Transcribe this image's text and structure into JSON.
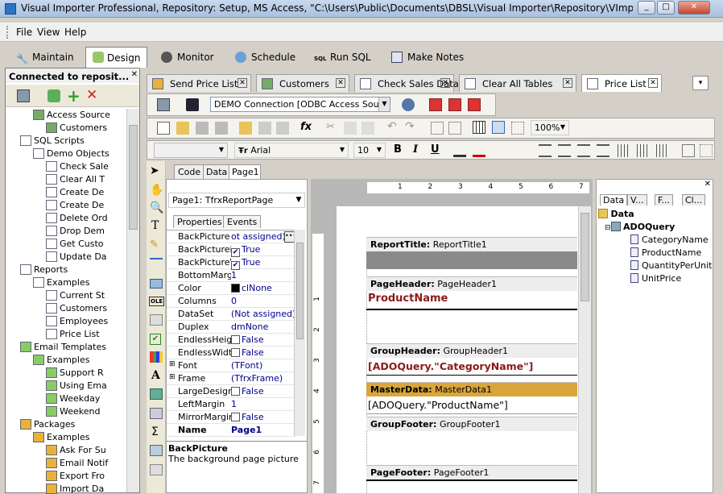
{
  "window": {
    "title": "Visual Importer Professional, Repository: Setup, MS Access, \"C:\\Users\\Public\\Documents\\DBSL\\Visual Importer\\Repository\\VImpRepository.m..."
  },
  "menu": [
    "File",
    "View",
    "Help"
  ],
  "main_tabs": [
    {
      "label": "Maintain",
      "icon": "wrench-icon"
    },
    {
      "label": "Design",
      "icon": "design-icon"
    },
    {
      "label": "Monitor",
      "icon": "binoculars-icon"
    },
    {
      "label": "Schedule",
      "icon": "clock-icon"
    },
    {
      "label": "Run SQL",
      "icon": "sql-icon"
    },
    {
      "label": "Make Notes",
      "icon": "notes-icon"
    }
  ],
  "left_panel": {
    "title": "Connected to reposit...",
    "tree": [
      {
        "label": "Access Source",
        "level": 3,
        "icon": "batch-icon"
      },
      {
        "label": "Customers",
        "level": 4,
        "icon": "batch-icon"
      },
      {
        "label": "SQL Scripts",
        "level": 2,
        "icon": "sql-icon"
      },
      {
        "label": "Demo Objects",
        "level": 3,
        "icon": "sql-icon"
      },
      {
        "label": "Check Sale",
        "level": 4,
        "icon": "sql-icon"
      },
      {
        "label": "Clear All T",
        "level": 4,
        "icon": "sql-icon"
      },
      {
        "label": "Create De",
        "level": 4,
        "icon": "sql-icon"
      },
      {
        "label": "Create De",
        "level": 4,
        "icon": "sql-icon"
      },
      {
        "label": "Delete Ord",
        "level": 4,
        "icon": "sql-icon"
      },
      {
        "label": "Drop Dem",
        "level": 4,
        "icon": "sql-icon"
      },
      {
        "label": "Get Custo",
        "level": 4,
        "icon": "sql-icon"
      },
      {
        "label": "Update Da",
        "level": 4,
        "icon": "sql-icon"
      },
      {
        "label": "Reports",
        "level": 2,
        "icon": "report-icon"
      },
      {
        "label": "Examples",
        "level": 3,
        "icon": "report-icon"
      },
      {
        "label": "Current St",
        "level": 4,
        "icon": "report-icon"
      },
      {
        "label": "Customers",
        "level": 4,
        "icon": "report-icon"
      },
      {
        "label": "Employees",
        "level": 4,
        "icon": "report-icon"
      },
      {
        "label": "Price List",
        "level": 4,
        "icon": "report-icon"
      },
      {
        "label": "Email Templates",
        "level": 2,
        "icon": "email-icon"
      },
      {
        "label": "Examples",
        "level": 3,
        "icon": "email-icon"
      },
      {
        "label": "Support R",
        "level": 4,
        "icon": "email-icon"
      },
      {
        "label": "Using Ema",
        "level": 4,
        "icon": "email-icon"
      },
      {
        "label": "Weekday",
        "level": 4,
        "icon": "email-icon"
      },
      {
        "label": "Weekend",
        "level": 4,
        "icon": "email-icon"
      },
      {
        "label": "Packages",
        "level": 2,
        "icon": "package-icon"
      },
      {
        "label": "Examples",
        "level": 3,
        "icon": "package-icon"
      },
      {
        "label": "Ask For Su",
        "level": 4,
        "icon": "package-icon"
      },
      {
        "label": "Email Notif",
        "level": 4,
        "icon": "package-icon"
      },
      {
        "label": "Export Fro",
        "level": 4,
        "icon": "package-icon"
      },
      {
        "label": "Import Da",
        "level": 4,
        "icon": "package-icon"
      }
    ]
  },
  "doc_tabs": [
    {
      "label": "Send Price List",
      "icon": "package-icon"
    },
    {
      "label": "Customers",
      "icon": "batch-icon"
    },
    {
      "label": "Check Sales Data",
      "icon": "sql-icon"
    },
    {
      "label": "Clear All Tables",
      "icon": "sql-icon"
    },
    {
      "label": "Price List",
      "icon": "report-icon"
    }
  ],
  "connection": "DEMO Connection [ODBC Access Source]",
  "zoom": "100%",
  "font": {
    "name": "Arial",
    "size": "10"
  },
  "fmt_buttons": [
    "B",
    "I",
    "U"
  ],
  "view_tabs": [
    "Code",
    "Data",
    "Page1"
  ],
  "object_selector": "Page1: TfrxReportPage",
  "inspector_tabs": [
    "Properties",
    "Events"
  ],
  "properties": [
    {
      "name": "BackPicture",
      "value": "ot assigned)",
      "expand": false
    },
    {
      "name": "BackPictureP",
      "value": "True",
      "check": true
    },
    {
      "name": "BackPictureVi",
      "value": "True",
      "check": true
    },
    {
      "name": "BottomMargin",
      "value": "1"
    },
    {
      "name": "Color",
      "value": "clNone",
      "swatch": true
    },
    {
      "name": "Columns",
      "value": "0"
    },
    {
      "name": "DataSet",
      "value": "(Not assigned)"
    },
    {
      "name": "Duplex",
      "value": "dmNone"
    },
    {
      "name": "EndlessHeigh",
      "value": "False",
      "check": false
    },
    {
      "name": "EndlessWidth",
      "value": "False",
      "check": false
    },
    {
      "name": "Font",
      "value": "(TFont)",
      "expand": true
    },
    {
      "name": "Frame",
      "value": "(TfrxFrame)",
      "expand": true
    },
    {
      "name": "LargeDesignH",
      "value": "False",
      "check": false
    },
    {
      "name": "LeftMargin",
      "value": "1"
    },
    {
      "name": "MirrorMargins",
      "value": "False",
      "check": false
    },
    {
      "name": "Name",
      "value": "Page1",
      "bold": true
    }
  ],
  "description": {
    "title": "BackPicture",
    "text": "The background page picture"
  },
  "ruler_marks": [
    "1",
    "2",
    "3",
    "4",
    "5",
    "6",
    "7"
  ],
  "bands": [
    {
      "header": "ReportTitle:",
      "name": "ReportTitle1",
      "content": ""
    },
    {
      "header": "PageHeader:",
      "name": "PageHeader1",
      "content": "ProductName"
    },
    {
      "header": "GroupHeader:",
      "name": "GroupHeader1",
      "content": "[ADOQuery.\"CategoryName\"]"
    },
    {
      "header": "MasterData:",
      "name": "MasterData1",
      "content": "[ADOQuery.\"ProductName\"]"
    },
    {
      "header": "GroupFooter:",
      "name": "GroupFooter1",
      "content": ""
    },
    {
      "header": "PageFooter:",
      "name": "PageFooter1",
      "content": ""
    }
  ],
  "data_tabs": [
    "Data",
    "V...",
    "F...",
    "Cl..."
  ],
  "data_tree": {
    "root": "Data",
    "query": "ADOQuery",
    "fields": [
      "CategoryName",
      "ProductName",
      "QuantityPerUnit",
      "UnitPrice"
    ]
  }
}
